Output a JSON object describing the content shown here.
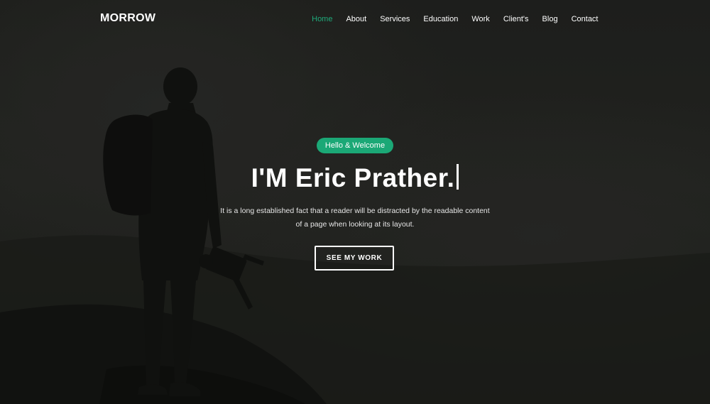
{
  "brand": {
    "name": "MORROW"
  },
  "nav": {
    "items": [
      {
        "label": "Home",
        "active": true
      },
      {
        "label": "About"
      },
      {
        "label": "Services"
      },
      {
        "label": "Education"
      },
      {
        "label": "Work"
      },
      {
        "label": "Client's"
      },
      {
        "label": "Blog"
      },
      {
        "label": "Contact"
      }
    ],
    "active_color": "#1fa97a"
  },
  "hero": {
    "badge": "Hello & Welcome",
    "headline": "I'M Eric Prather.",
    "description_line1": "It is a long established fact that a reader will be distracted by the readable content",
    "description_line2": "of a page when looking at its layout.",
    "cta_label": "SEE MY WORK",
    "accent_color": "#1ba876"
  }
}
